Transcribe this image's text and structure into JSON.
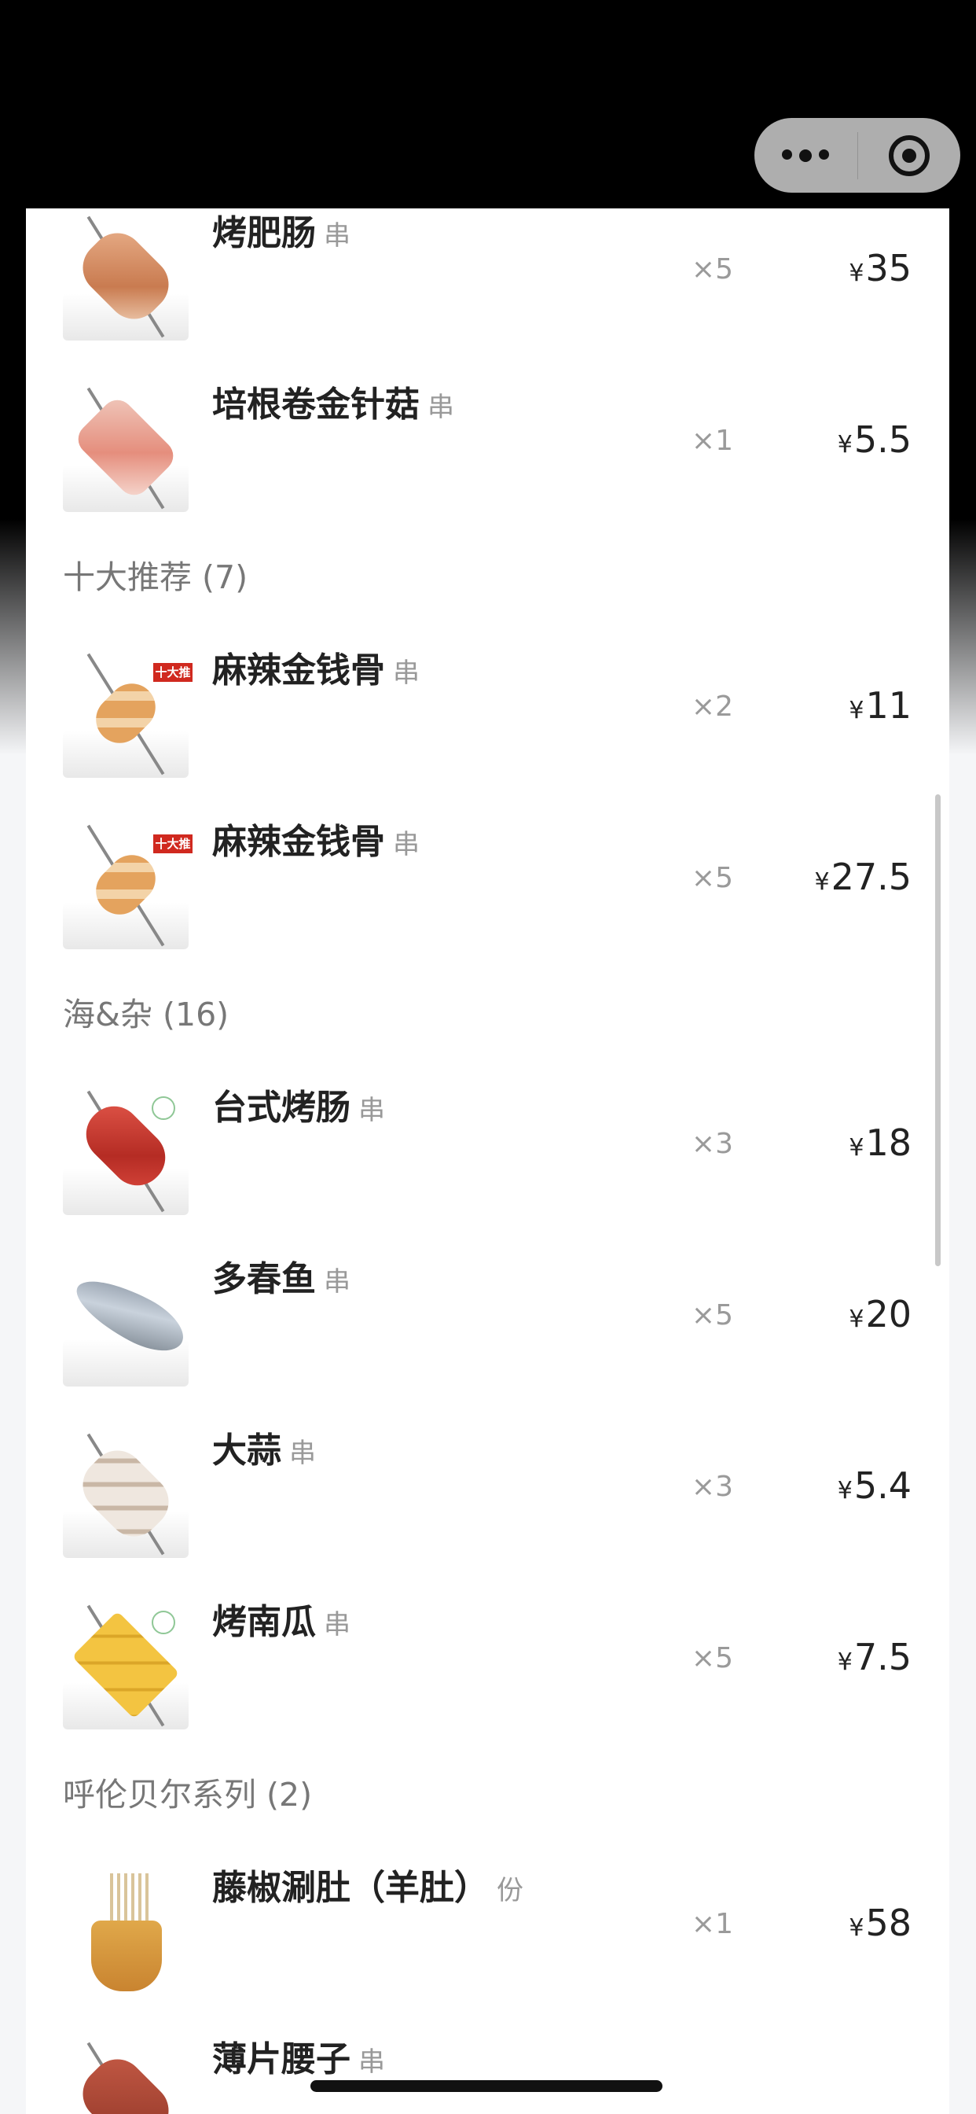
{
  "capsule": {
    "more_icon": "ellipsis-icon",
    "close_icon": "target-icon"
  },
  "items_top": [
    {
      "name": "烤肥肠",
      "unit": "串",
      "qty": "×5",
      "price": "35",
      "currency": "¥"
    },
    {
      "name": "培根卷金针菇",
      "unit": "串",
      "qty": "×1",
      "price": "5.5",
      "currency": "¥"
    }
  ],
  "sections": [
    {
      "title": "十大推荐 (7)",
      "items": [
        {
          "name": "麻辣金钱骨",
          "unit": "串",
          "qty": "×2",
          "price": "11",
          "currency": "¥",
          "tag": "十大推"
        },
        {
          "name": "麻辣金钱骨",
          "unit": "串",
          "qty": "×5",
          "price": "27.5",
          "currency": "¥",
          "tag": "十大推"
        }
      ]
    },
    {
      "title": "海&杂 (16)",
      "items": [
        {
          "name": "台式烤肠",
          "unit": "串",
          "qty": "×3",
          "price": "18",
          "currency": "¥"
        },
        {
          "name": "多春鱼",
          "unit": "串",
          "qty": "×5",
          "price": "20",
          "currency": "¥"
        },
        {
          "name": "大蒜",
          "unit": "串",
          "qty": "×3",
          "price": "5.4",
          "currency": "¥"
        },
        {
          "name": "烤南瓜",
          "unit": "串",
          "qty": "×5",
          "price": "7.5",
          "currency": "¥"
        }
      ]
    },
    {
      "title": "呼伦贝尔系列 (2)",
      "items": [
        {
          "name": "藤椒涮肚（羊肚）",
          "unit": "份",
          "qty": "×1",
          "price": "58",
          "currency": "¥"
        },
        {
          "name": "薄片腰子",
          "unit": "串",
          "qty": "",
          "price": "",
          "currency": ""
        }
      ]
    }
  ],
  "colors": {
    "tag_red": "#d0291f",
    "text_dark": "#222222",
    "text_muted": "#9a9a9a"
  }
}
